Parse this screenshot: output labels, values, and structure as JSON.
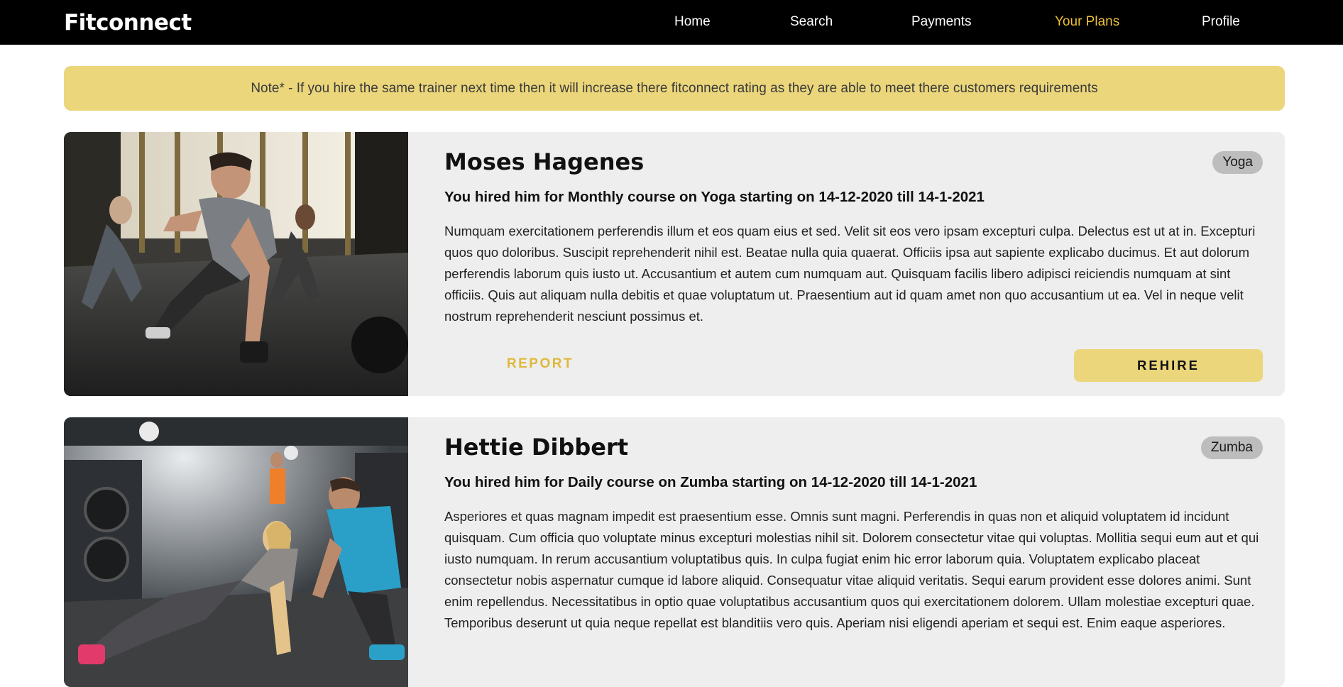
{
  "navbar": {
    "brand": "Fitconnect",
    "links": [
      {
        "label": "Home",
        "active": false
      },
      {
        "label": "Search",
        "active": false
      },
      {
        "label": "Payments",
        "active": false
      },
      {
        "label": "Your Plans",
        "active": true
      },
      {
        "label": "Profile",
        "active": false
      }
    ]
  },
  "note": {
    "text": "Note* - If you hire the same trainer next time then it will increase there fitconnect rating as they are able to meet there customers requirements"
  },
  "plans": [
    {
      "name": "Moses Hagenes",
      "tag": "Yoga",
      "hire_text": "You hired him for Monthly course on Yoga starting on 14-12-2020 till 14-1-2021",
      "description": "Numquam exercitationem perferendis illum et eos quam eius et sed. Velit sit eos vero ipsam excepturi culpa. Delectus est ut at in. Excepturi quos quo doloribus. Suscipit reprehenderit nihil est. Beatae nulla quia quaerat. Officiis ipsa aut sapiente explicabo ducimus. Et aut dolorum perferendis laborum quis iusto ut. Accusantium et autem cum numquam aut. Quisquam facilis libero adipisci reiciendis numquam at sint officiis. Quis aut aliquam nulla debitis et quae voluptatum ut. Praesentium aut id quam amet non quo accusantium ut ea. Vel in neque velit nostrum reprehenderit nesciunt possimus et.",
      "report_label": "REPORT",
      "rehire_label": "REHIRE"
    },
    {
      "name": "Hettie Dibbert",
      "tag": "Zumba",
      "hire_text": "You hired him for Daily course on Zumba starting on 14-12-2020 till 14-1-2021",
      "description": "Asperiores et quas magnam impedit est praesentium esse. Omnis sunt magni. Perferendis in quas non et aliquid voluptatem id incidunt quisquam. Cum officia quo voluptate minus excepturi molestias nihil sit. Dolorem consectetur vitae qui voluptas. Mollitia sequi eum aut et qui iusto numquam. In rerum accusantium voluptatibus quis. In culpa fugiat enim hic error laborum quia. Voluptatem explicabo placeat consectetur nobis aspernatur cumque id labore aliquid. Consequatur vitae aliquid veritatis. Sequi earum provident esse dolores animi. Sunt enim repellendus. Necessitatibus in optio quae voluptatibus accusantium quos qui exercitationem dolorem. Ullam molestiae excepturi quae. Temporibus deserunt ut quia neque repellat est blanditiis vero quis. Aperiam nisi eligendi aperiam et sequi est. Enim eaque asperiores."
    }
  ],
  "colors": {
    "navbar_bg": "#000000",
    "accent": "#ecbf3a",
    "note_bg": "#ebd67b",
    "card_bg": "#eeeeee",
    "tag_bg": "#bdbdbd"
  }
}
